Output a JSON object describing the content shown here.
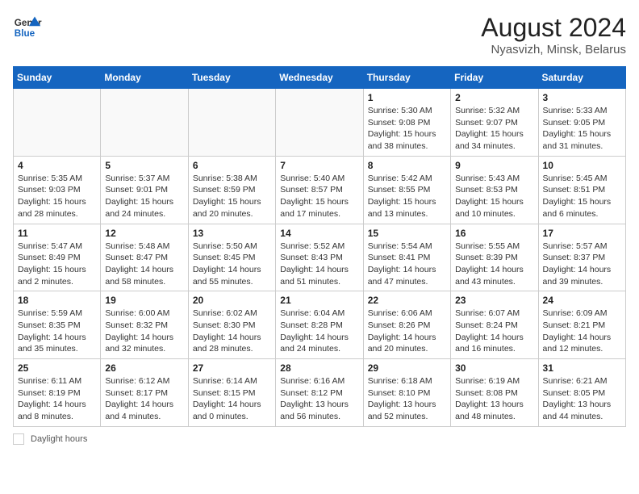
{
  "header": {
    "logo_line1": "General",
    "logo_line2": "Blue",
    "month_year": "August 2024",
    "location": "Nyasvizh, Minsk, Belarus"
  },
  "weekdays": [
    "Sunday",
    "Monday",
    "Tuesday",
    "Wednesday",
    "Thursday",
    "Friday",
    "Saturday"
  ],
  "weeks": [
    [
      {
        "day": "",
        "info": ""
      },
      {
        "day": "",
        "info": ""
      },
      {
        "day": "",
        "info": ""
      },
      {
        "day": "",
        "info": ""
      },
      {
        "day": "1",
        "info": "Sunrise: 5:30 AM\nSunset: 9:08 PM\nDaylight: 15 hours\nand 38 minutes."
      },
      {
        "day": "2",
        "info": "Sunrise: 5:32 AM\nSunset: 9:07 PM\nDaylight: 15 hours\nand 34 minutes."
      },
      {
        "day": "3",
        "info": "Sunrise: 5:33 AM\nSunset: 9:05 PM\nDaylight: 15 hours\nand 31 minutes."
      }
    ],
    [
      {
        "day": "4",
        "info": "Sunrise: 5:35 AM\nSunset: 9:03 PM\nDaylight: 15 hours\nand 28 minutes."
      },
      {
        "day": "5",
        "info": "Sunrise: 5:37 AM\nSunset: 9:01 PM\nDaylight: 15 hours\nand 24 minutes."
      },
      {
        "day": "6",
        "info": "Sunrise: 5:38 AM\nSunset: 8:59 PM\nDaylight: 15 hours\nand 20 minutes."
      },
      {
        "day": "7",
        "info": "Sunrise: 5:40 AM\nSunset: 8:57 PM\nDaylight: 15 hours\nand 17 minutes."
      },
      {
        "day": "8",
        "info": "Sunrise: 5:42 AM\nSunset: 8:55 PM\nDaylight: 15 hours\nand 13 minutes."
      },
      {
        "day": "9",
        "info": "Sunrise: 5:43 AM\nSunset: 8:53 PM\nDaylight: 15 hours\nand 10 minutes."
      },
      {
        "day": "10",
        "info": "Sunrise: 5:45 AM\nSunset: 8:51 PM\nDaylight: 15 hours\nand 6 minutes."
      }
    ],
    [
      {
        "day": "11",
        "info": "Sunrise: 5:47 AM\nSunset: 8:49 PM\nDaylight: 15 hours\nand 2 minutes."
      },
      {
        "day": "12",
        "info": "Sunrise: 5:48 AM\nSunset: 8:47 PM\nDaylight: 14 hours\nand 58 minutes."
      },
      {
        "day": "13",
        "info": "Sunrise: 5:50 AM\nSunset: 8:45 PM\nDaylight: 14 hours\nand 55 minutes."
      },
      {
        "day": "14",
        "info": "Sunrise: 5:52 AM\nSunset: 8:43 PM\nDaylight: 14 hours\nand 51 minutes."
      },
      {
        "day": "15",
        "info": "Sunrise: 5:54 AM\nSunset: 8:41 PM\nDaylight: 14 hours\nand 47 minutes."
      },
      {
        "day": "16",
        "info": "Sunrise: 5:55 AM\nSunset: 8:39 PM\nDaylight: 14 hours\nand 43 minutes."
      },
      {
        "day": "17",
        "info": "Sunrise: 5:57 AM\nSunset: 8:37 PM\nDaylight: 14 hours\nand 39 minutes."
      }
    ],
    [
      {
        "day": "18",
        "info": "Sunrise: 5:59 AM\nSunset: 8:35 PM\nDaylight: 14 hours\nand 35 minutes."
      },
      {
        "day": "19",
        "info": "Sunrise: 6:00 AM\nSunset: 8:32 PM\nDaylight: 14 hours\nand 32 minutes."
      },
      {
        "day": "20",
        "info": "Sunrise: 6:02 AM\nSunset: 8:30 PM\nDaylight: 14 hours\nand 28 minutes."
      },
      {
        "day": "21",
        "info": "Sunrise: 6:04 AM\nSunset: 8:28 PM\nDaylight: 14 hours\nand 24 minutes."
      },
      {
        "day": "22",
        "info": "Sunrise: 6:06 AM\nSunset: 8:26 PM\nDaylight: 14 hours\nand 20 minutes."
      },
      {
        "day": "23",
        "info": "Sunrise: 6:07 AM\nSunset: 8:24 PM\nDaylight: 14 hours\nand 16 minutes."
      },
      {
        "day": "24",
        "info": "Sunrise: 6:09 AM\nSunset: 8:21 PM\nDaylight: 14 hours\nand 12 minutes."
      }
    ],
    [
      {
        "day": "25",
        "info": "Sunrise: 6:11 AM\nSunset: 8:19 PM\nDaylight: 14 hours\nand 8 minutes."
      },
      {
        "day": "26",
        "info": "Sunrise: 6:12 AM\nSunset: 8:17 PM\nDaylight: 14 hours\nand 4 minutes."
      },
      {
        "day": "27",
        "info": "Sunrise: 6:14 AM\nSunset: 8:15 PM\nDaylight: 14 hours\nand 0 minutes."
      },
      {
        "day": "28",
        "info": "Sunrise: 6:16 AM\nSunset: 8:12 PM\nDaylight: 13 hours\nand 56 minutes."
      },
      {
        "day": "29",
        "info": "Sunrise: 6:18 AM\nSunset: 8:10 PM\nDaylight: 13 hours\nand 52 minutes."
      },
      {
        "day": "30",
        "info": "Sunrise: 6:19 AM\nSunset: 8:08 PM\nDaylight: 13 hours\nand 48 minutes."
      },
      {
        "day": "31",
        "info": "Sunrise: 6:21 AM\nSunset: 8:05 PM\nDaylight: 13 hours\nand 44 minutes."
      }
    ]
  ],
  "footer": {
    "daylight_label": "Daylight hours"
  }
}
